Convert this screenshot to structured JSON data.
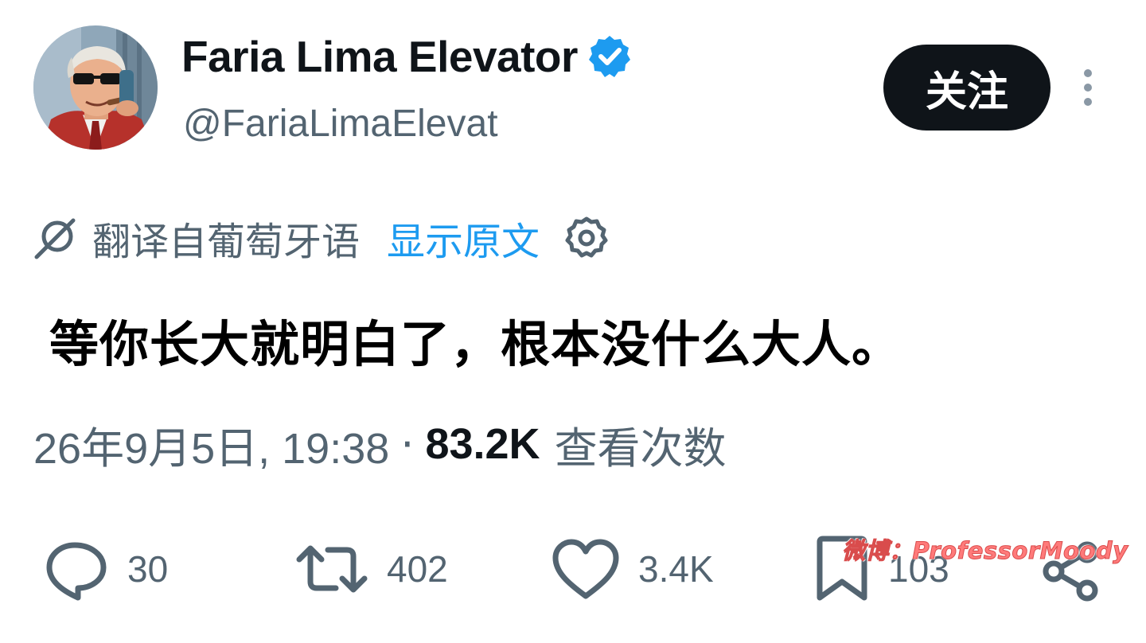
{
  "author": {
    "display_name": "Faria Lima Elevator",
    "handle": "@FariaLimaElevat",
    "verified": true,
    "verified_color": "#1d9bf0"
  },
  "header": {
    "follow_label": "关注"
  },
  "translation": {
    "label": "翻译自葡萄牙语",
    "show_original": "显示原文",
    "link_color": "#1d9bf0"
  },
  "tweet": {
    "text": "等你长大就明白了，根本没什么大人。"
  },
  "meta": {
    "timestamp": "26年9月5日, 19:38",
    "separator": "·",
    "views_count": "83.2K",
    "views_label": "查看次数"
  },
  "actions": {
    "replies": "30",
    "reposts": "402",
    "likes": "3.4K",
    "bookmarks": "103"
  },
  "watermark": {
    "text": "微博：ProfessorMoody"
  },
  "colors": {
    "text_primary": "#0f1419",
    "text_secondary": "#536471",
    "button_bg": "#0f1419"
  }
}
